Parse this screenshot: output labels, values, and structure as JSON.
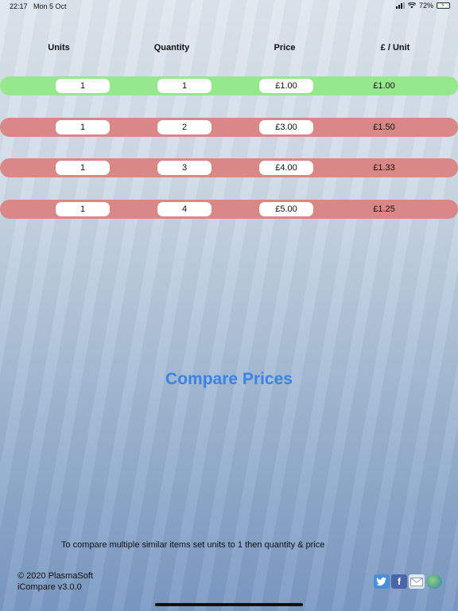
{
  "status_bar": {
    "time": "22:17",
    "date": "Mon 5 Oct",
    "battery": "72%"
  },
  "headers": {
    "units": "Units",
    "quantity": "Quantity",
    "price": "Price",
    "per_unit": "£ / Unit"
  },
  "rows": [
    {
      "units": "1",
      "quantity": "1",
      "price": "£1.00",
      "per_unit": "£1.00",
      "state": "best"
    },
    {
      "units": "1",
      "quantity": "2",
      "price": "£3.00",
      "per_unit": "£1.50",
      "state": "worse"
    },
    {
      "units": "1",
      "quantity": "3",
      "price": "£4.00",
      "per_unit": "£1.33",
      "state": "worse"
    },
    {
      "units": "1",
      "quantity": "4",
      "price": "£5.00",
      "per_unit": "£1.25",
      "state": "worse"
    }
  ],
  "compare_button": "Compare Prices",
  "instructions": "To compare multiple similar items set units to 1 then quantity & price",
  "footer": {
    "copyright": "© 2020 PlasmaSoft",
    "version": "iCompare v3.0.0"
  },
  "colors": {
    "best": "#95e88c",
    "worse": "#d98787",
    "accent": "#3b82e6"
  },
  "social_icons": [
    "twitter-icon",
    "facebook-icon",
    "mail-icon",
    "globe-icon"
  ]
}
